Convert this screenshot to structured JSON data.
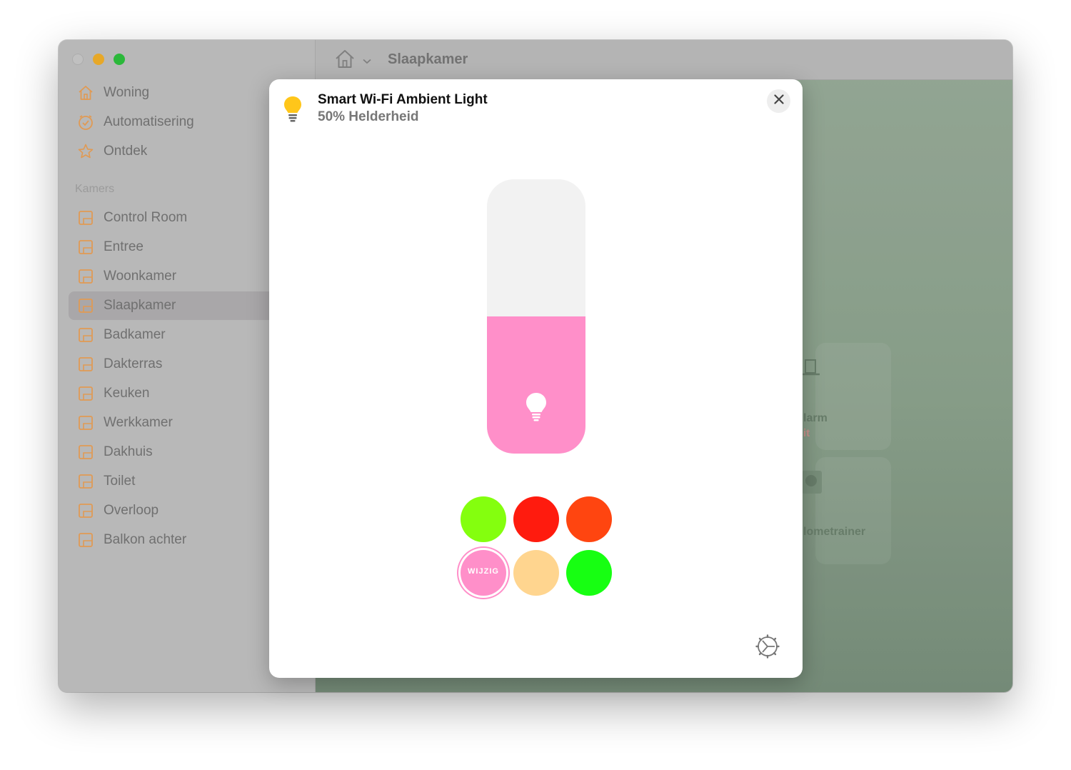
{
  "window": {
    "toolbar_title": "Slaapkamer"
  },
  "sidebar": {
    "top_items": [
      {
        "label": "Woning",
        "icon": "house-icon"
      },
      {
        "label": "Automatisering",
        "icon": "clock-check-icon"
      },
      {
        "label": "Ontdek",
        "icon": "star-icon"
      }
    ],
    "section_label": "Kamers",
    "rooms": [
      {
        "label": "Control Room"
      },
      {
        "label": "Entree"
      },
      {
        "label": "Woonkamer"
      },
      {
        "label": "Slaapkamer",
        "active": true
      },
      {
        "label": "Badkamer"
      },
      {
        "label": "Dakterras"
      },
      {
        "label": "Keuken"
      },
      {
        "label": "Werkkamer"
      },
      {
        "label": "Dakhuis"
      },
      {
        "label": "Toilet"
      },
      {
        "label": "Overloop"
      },
      {
        "label": "Balkon achter"
      }
    ]
  },
  "background_tiles": {
    "tile1_text": "larm",
    "tile1_status": "it",
    "tile2_text": "lometrainer"
  },
  "modal": {
    "title": "Smart Wi-Fi Ambient Light",
    "subtitle": "50% Helderheid",
    "brightness_percent": 50,
    "fill_color": "#ff8fc9",
    "swatches": [
      {
        "color": "#84ff0e"
      },
      {
        "color": "#ff1b0e"
      },
      {
        "color": "#ff4510"
      },
      {
        "color": "#ff8fc9",
        "label": "WIJZIG",
        "selected": true
      },
      {
        "color": "#ffd58f"
      },
      {
        "color": "#17ff12"
      }
    ]
  },
  "colors": {
    "accent": "#f0a24a",
    "bulb": "#ffc61a"
  }
}
